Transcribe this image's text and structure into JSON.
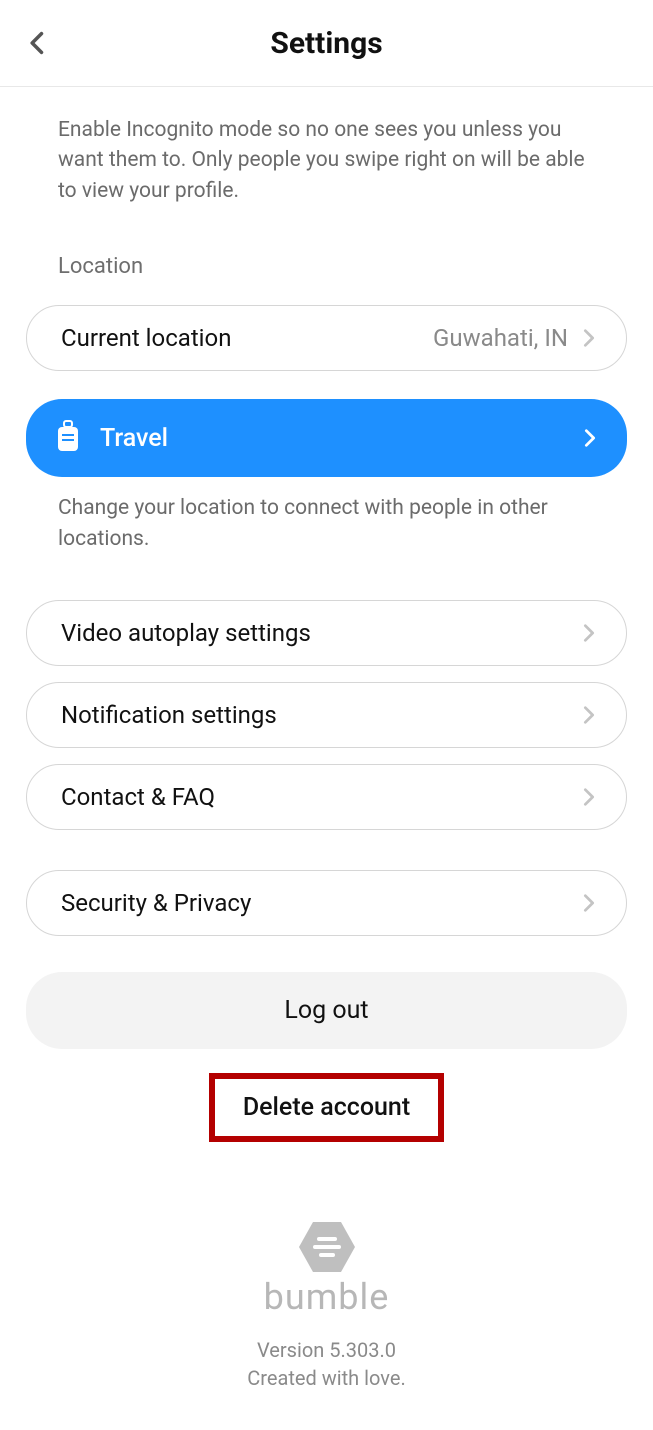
{
  "header": {
    "title": "Settings"
  },
  "incognito": {
    "hint": "Enable Incognito mode so no one sees you unless you want them to. Only people you swipe right on will be able to view your profile."
  },
  "location": {
    "section_label": "Location",
    "current_label": "Current location",
    "current_value": "Guwahati, IN",
    "travel_label": "Travel",
    "travel_hint": "Change your location to connect with people in other locations."
  },
  "rows": {
    "video": "Video autoplay settings",
    "notifications": "Notification settings",
    "contact": "Contact & FAQ",
    "security": "Security & Privacy"
  },
  "logout": "Log out",
  "delete": "Delete account",
  "footer": {
    "brand": "bumble",
    "version": "Version 5.303.0",
    "tagline": "Created with love."
  },
  "colors": {
    "accent": "#1e90ff",
    "highlight_border": "#b40000"
  }
}
